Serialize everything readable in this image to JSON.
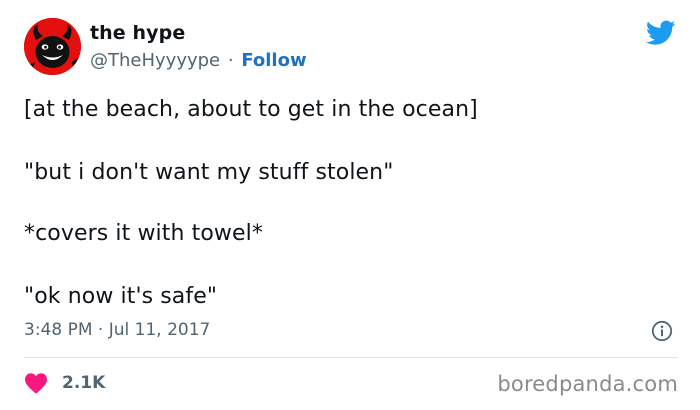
{
  "tweet": {
    "author": {
      "name": "the hype",
      "handle": "@TheHyyyype",
      "separator": "·",
      "follow_label": "Follow",
      "avatar_icon": "devil-face-avatar"
    },
    "brand_icon": "twitter-bird-icon",
    "body_lines": [
      "[at the beach, about to get in the ocean]",
      "\"but i don't want my stuff stolen\"",
      "*covers it with towel*",
      "\"ok now it's safe\""
    ],
    "timestamp": "3:48 PM · Jul 11, 2017",
    "likes": "2.1K"
  },
  "watermark": "boredpanda.com",
  "colors": {
    "accent": "#1d9bf0",
    "follow": "#1d72c4",
    "heart": "#f91880",
    "secondary_text": "#536471",
    "avatar_bg": "#e3100f"
  }
}
